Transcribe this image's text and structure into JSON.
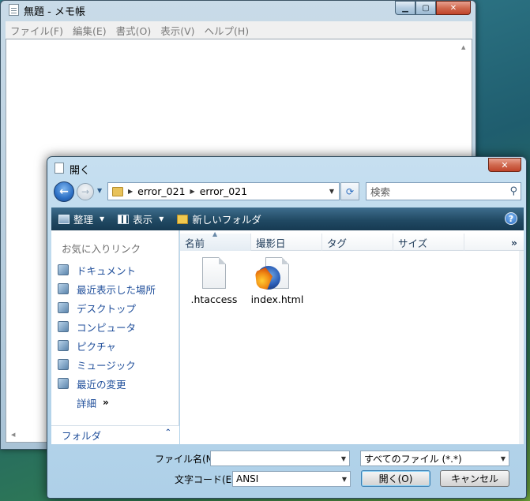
{
  "notepad": {
    "title": "無題 - メモ帳",
    "menu": [
      "ファイル(F)",
      "編集(E)",
      "書式(O)",
      "表示(V)",
      "ヘルプ(H)"
    ],
    "content": ""
  },
  "dialog": {
    "title": "開く",
    "address": {
      "crumbs": [
        "error_021",
        "error_021"
      ]
    },
    "search": {
      "placeholder": "検索"
    },
    "toolbar": {
      "organize": "整理",
      "views": "表示",
      "new_folder": "新しいフォルダ",
      "help": "?"
    },
    "favorites": {
      "header": "お気に入りリンク",
      "items": [
        {
          "label": "ドキュメント",
          "icon": "documents-icon"
        },
        {
          "label": "最近表示した場所",
          "icon": "recent-places-icon"
        },
        {
          "label": "デスクトップ",
          "icon": "desktop-icon"
        },
        {
          "label": "コンピュータ",
          "icon": "computer-icon"
        },
        {
          "label": "ピクチャ",
          "icon": "pictures-icon"
        },
        {
          "label": "ミュージック",
          "icon": "music-icon"
        },
        {
          "label": "最近の変更",
          "icon": "recently-changed-icon"
        }
      ],
      "more": "詳細",
      "more_chevron": "»"
    },
    "folders_label": "フォルダ",
    "columns": [
      "名前",
      "撮影日",
      "タグ",
      "サイズ",
      "»"
    ],
    "files": [
      {
        "name": ".htaccess",
        "icon": "document-icon"
      },
      {
        "name": "index.html",
        "icon": "firefox-html-icon"
      }
    ],
    "filename_label": "ファイル名(N):",
    "filename_value": "",
    "filetype_value": "すべてのファイル (*.*)",
    "encoding_label": "文字コード(E):",
    "encoding_value": "ANSI",
    "open_button": "開く(O)",
    "cancel_button": "キャンセル"
  }
}
